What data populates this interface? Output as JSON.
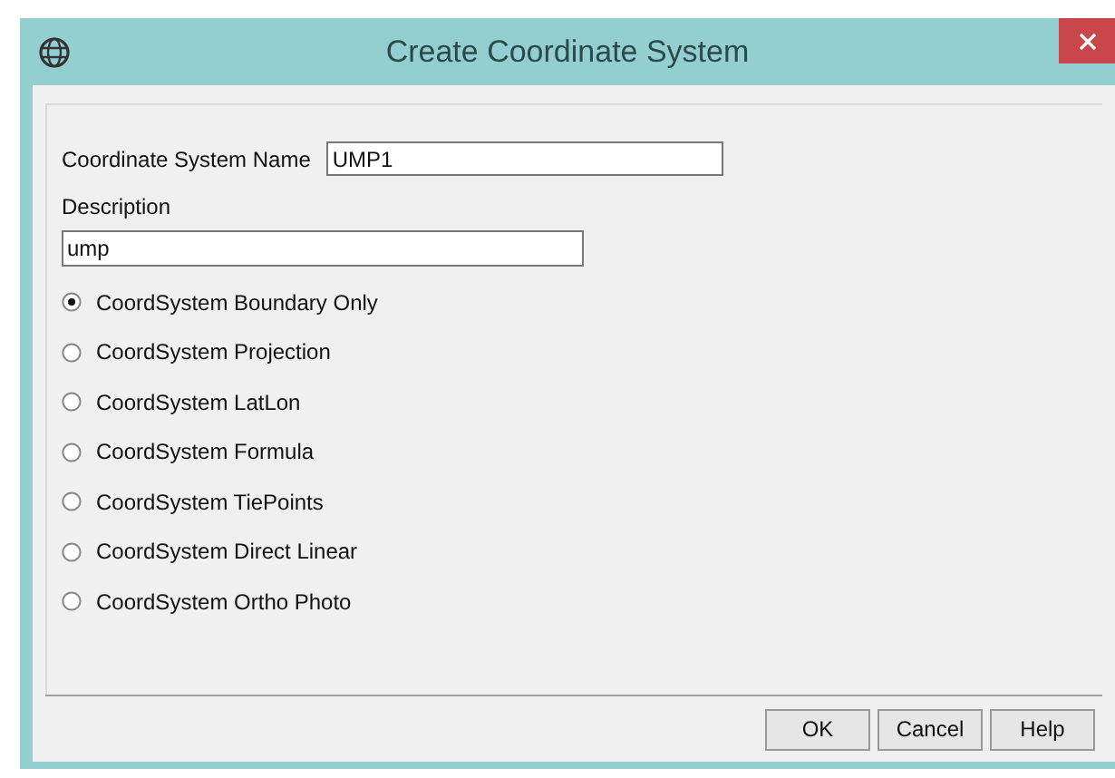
{
  "window": {
    "title": "Create Coordinate System"
  },
  "name_field": {
    "label": "Coordinate System Name",
    "value": "UMP1"
  },
  "description_field": {
    "label": "Description",
    "value": "ump"
  },
  "options": [
    {
      "label": "CoordSystem Boundary Only",
      "selected": true
    },
    {
      "label": "CoordSystem Projection",
      "selected": false
    },
    {
      "label": "CoordSystem LatLon",
      "selected": false
    },
    {
      "label": "CoordSystem Formula",
      "selected": false
    },
    {
      "label": "CoordSystem TiePoints",
      "selected": false
    },
    {
      "label": "CoordSystem Direct Linear",
      "selected": false
    },
    {
      "label": "CoordSystem Ortho Photo",
      "selected": false
    }
  ],
  "buttons": [
    "OK",
    "Cancel",
    "Help"
  ]
}
